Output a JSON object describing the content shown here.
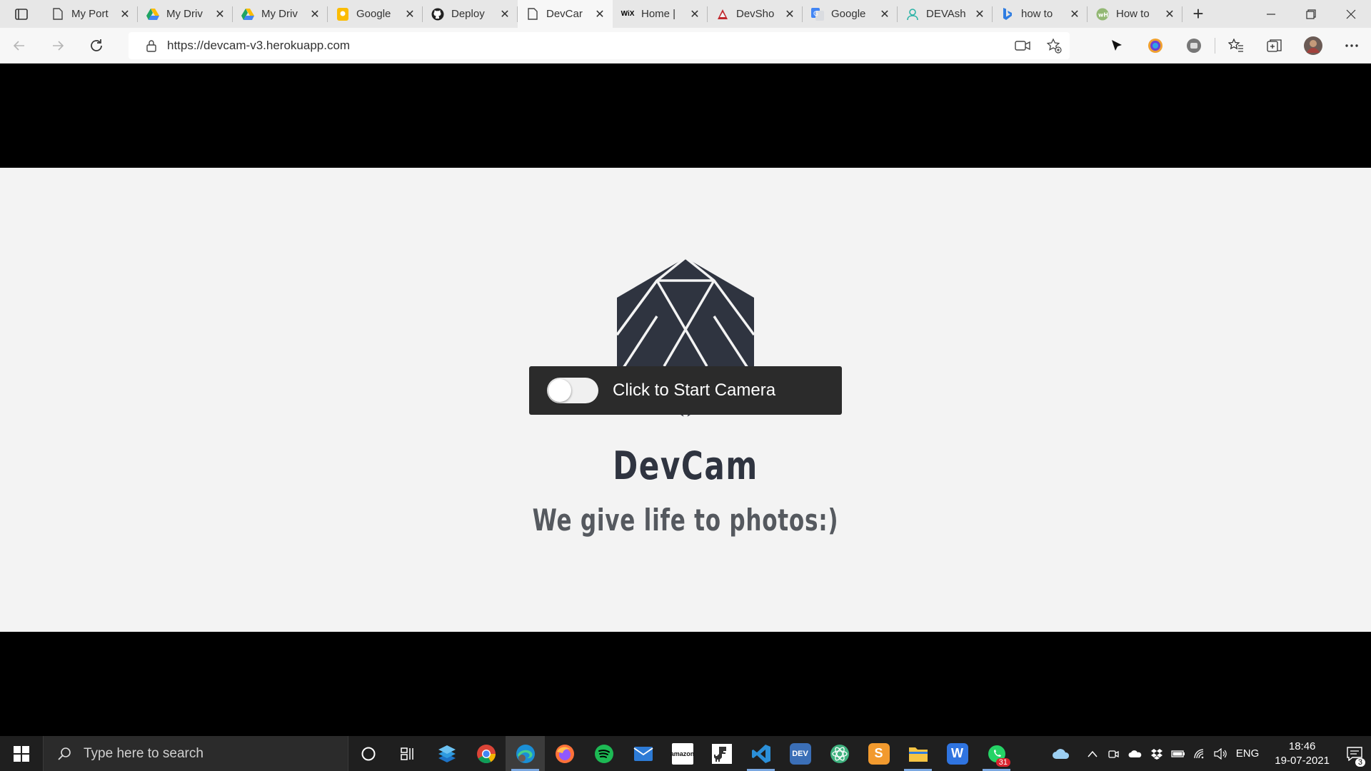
{
  "browser": {
    "tabs": [
      {
        "title": "My Port",
        "icon": "page-icon"
      },
      {
        "title": "My Driv",
        "icon": "google-drive-icon"
      },
      {
        "title": "My Driv",
        "icon": "google-drive-icon"
      },
      {
        "title": "Google",
        "icon": "google-keep-icon"
      },
      {
        "title": "Deploy",
        "icon": "github-icon"
      },
      {
        "title": "DevCar",
        "icon": "page-icon",
        "active": true
      },
      {
        "title": "Home |",
        "icon": "wix-icon"
      },
      {
        "title": "DevSho",
        "icon": "devshop-icon"
      },
      {
        "title": "Google",
        "icon": "google-translate-icon"
      },
      {
        "title": "DEVAsh",
        "icon": "user-icon"
      },
      {
        "title": "how to",
        "icon": "bing-icon"
      },
      {
        "title": "How to",
        "icon": "wikihow-icon"
      }
    ],
    "close_glyph": "✕",
    "new_tab_glyph": "+",
    "url": "https://devcam-v3.herokuapp.com"
  },
  "page": {
    "camera_toggle_label": "Click to Start Camera",
    "brand": "DevCam",
    "tagline": "We give life to photos:)"
  },
  "taskbar": {
    "search_placeholder": "Type here to search",
    "mail_badge": "31",
    "lang": "ENG",
    "time": "18:46",
    "date": "19-07-2021",
    "notification_count": "3",
    "apps": [
      {
        "name": "chrome-icon",
        "color": "#e8b322"
      },
      {
        "name": "edge-icon",
        "color": "#2aa3a0"
      },
      {
        "name": "firefox-icon",
        "color": "#ff7139"
      },
      {
        "name": "spotify-icon",
        "color": "#1db954"
      },
      {
        "name": "mail-icon",
        "color": "#2d7bd6"
      },
      {
        "name": "amazon-icon",
        "color": "#ffffff"
      },
      {
        "name": "dino-game-icon",
        "color": "#ffffff"
      },
      {
        "name": "vscode-icon",
        "color": "#2b8fd8"
      },
      {
        "name": "dev-icon",
        "color": "#3b6fb7"
      },
      {
        "name": "atom-icon",
        "color": "#3fb27f"
      },
      {
        "name": "sublime-icon",
        "color": "#f29a2e"
      },
      {
        "name": "file-explorer-icon",
        "color": "#f6c443"
      },
      {
        "name": "wps-icon",
        "color": "#2f74e0"
      },
      {
        "name": "whatsapp-icon",
        "color": "#25d366"
      }
    ]
  }
}
